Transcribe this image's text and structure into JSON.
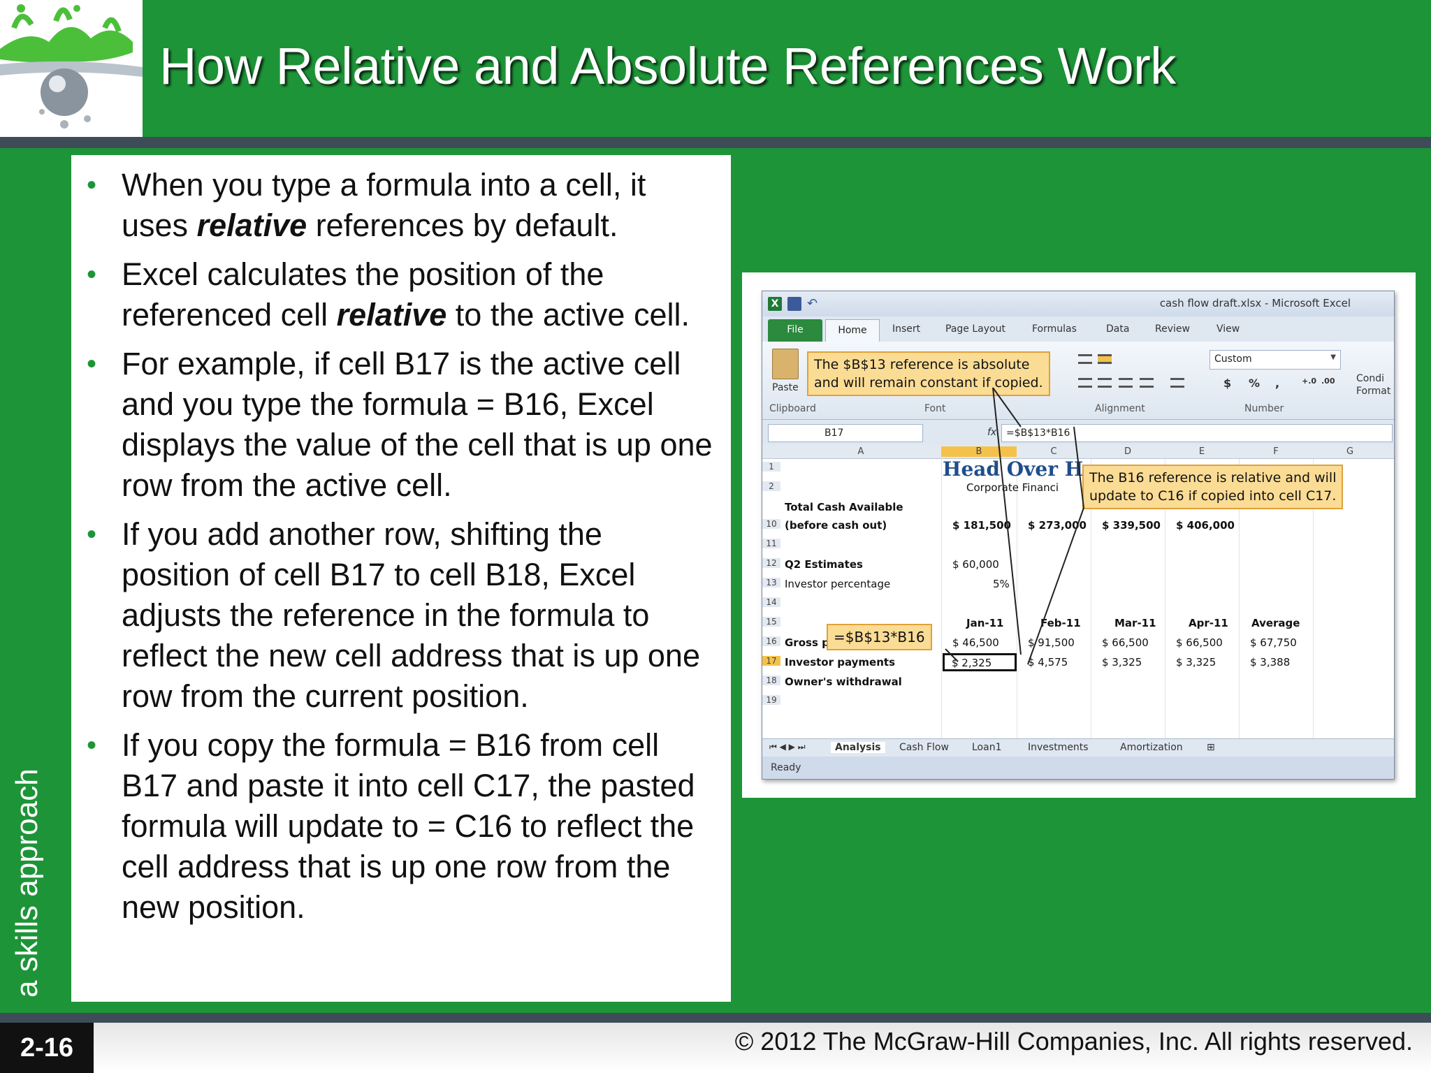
{
  "slide": {
    "title": "How Relative and Absolute References Work",
    "side_label": "a skills approach",
    "page_number": "2-16",
    "copyright": "© 2012 The McGraw-Hill Companies, Inc. All rights reserved."
  },
  "bullets": [
    [
      "When you type a formula into a cell, it uses ",
      "relative",
      " references by default."
    ],
    [
      "Excel calculates the position of the referenced cell ",
      "relative",
      " to the active cell."
    ],
    [
      "For example, if cell B17 is the active cell and you type the formula = B16, Excel displays the value of the cell that is up one row from the active cell.",
      "",
      ""
    ],
    [
      "If you add another row, shifting the position of cell B17 to cell B18, Excel adjusts the reference in the formula to reflect the new cell address that is up one row from the current position.",
      "",
      ""
    ],
    [
      "If you copy the formula = B16 from cell B17 and paste it into cell C17, the pasted formula will update to = C16 to reflect the cell address that is up one row from the new position.",
      "",
      ""
    ]
  ],
  "excel": {
    "window_title": "cash flow draft.xlsx - Microsoft Excel",
    "tabs": [
      "File",
      "Home",
      "Insert",
      "Page Layout",
      "Formulas",
      "Data",
      "Review",
      "View"
    ],
    "ribbon_groups": [
      "Clipboard",
      "Font",
      "Alignment",
      "Number"
    ],
    "paste_label": "Paste",
    "number_format": "Custom",
    "cond_format": "Condi Format",
    "name_box": "B17",
    "formula": "=$B$13*B16",
    "columns": [
      "A",
      "B",
      "C",
      "D",
      "E",
      "F",
      "G"
    ],
    "sheet_title": "Head Over H",
    "sheet_subtitle": "Corporate Financi",
    "rows": {
      "r1": "1",
      "r2": "2",
      "r10": "10",
      "r11": "11",
      "r12": "12",
      "r13": "13",
      "r14": "14",
      "r15": "15",
      "r16": "16",
      "r17": "17",
      "r18": "18",
      "r19": "19"
    },
    "labels": {
      "total_cash": "Total Cash Available",
      "before_cash_out": "(before cash out)",
      "q2_estimates": "Q2 Estimates",
      "investor_pct": "Investor percentage",
      "gross_profit": "Gross profit",
      "investor_payments": "Investor payments",
      "owners_withdrawal": "Owner's withdrawal"
    },
    "total_cash_values": [
      "$ 181,500",
      "$ 273,000",
      "$ 339,500",
      "$ 406,000"
    ],
    "q2_value": "$ 60,000",
    "pct_value": "5%",
    "month_headers": [
      "Jan-11",
      "Feb-11",
      "Mar-11",
      "Apr-11",
      "Average"
    ],
    "gross_profit_values": [
      "$ 46,500",
      "$ 91,500",
      "$ 66,500",
      "$ 66,500",
      "$ 67,750"
    ],
    "investor_payment_values": [
      "$ 2,325",
      "$ 4,575",
      "$ 3,325",
      "$ 3,325",
      "$ 3,388"
    ],
    "sheet_tabs": [
      "Analysis",
      "Cash Flow",
      "Loan1",
      "Investments",
      "Amortization"
    ],
    "status": "Ready"
  },
  "callouts": {
    "absolute_line1": "The $B$13 reference is absolute",
    "absolute_line2": "and will remain constant if copied.",
    "relative_line1": "The B16 reference is relative and will",
    "relative_line2": "update to C16 if copied into cell C17.",
    "formula_label": "=$B$13*B16"
  },
  "colors": {
    "slide_green": "#1e9438",
    "rule_gray": "#3e4c58",
    "callout_fill": "#fbdc95",
    "callout_border": "#e0a13a",
    "title_blue": "#1f4e8c"
  }
}
